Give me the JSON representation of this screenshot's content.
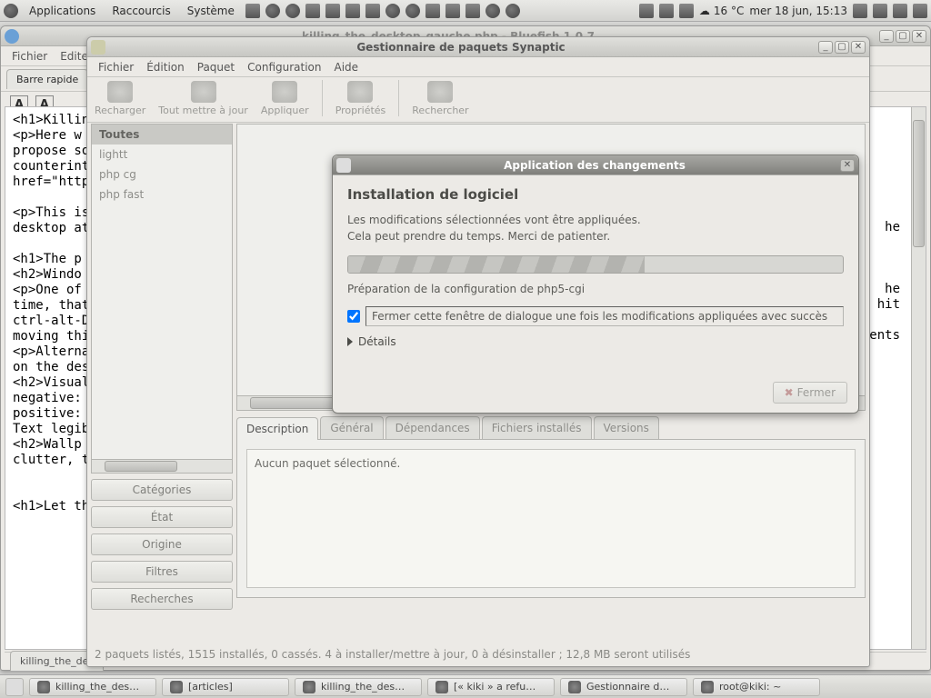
{
  "panel": {
    "menus": [
      "Applications",
      "Raccourcis",
      "Système"
    ],
    "weather": "16 °C",
    "clock": "mer 18 jun, 15:13"
  },
  "bluefish": {
    "title": "killing_the_desktop_gauche.php - Bluefish 1.0.7",
    "menus": [
      "Fichier",
      "Edite"
    ],
    "quickbar_tab": "Barre rapide",
    "doc_tab": "killing_the_des",
    "content": "<h1>Killing\n<p>Here w\npropose so\ncounterintu\nhref=\"http:/\n\n<p>This is\ndesktop at\n\n<h1>The p\n<h2>Windo\n<p>One of\ntime, that d\nctrl-alt-D, o\nmoving thin\n<p>Alterna\non the desk\n<h2>Visual\nnegative: d\npositive: m\nText legibili\n<h2>Wallp\nclutter, text\n\n\n<h1>Let th",
    "content_right": "he\n\n\n\nhe\nor hit\n\nents"
  },
  "synaptic": {
    "title": "Gestionnaire de paquets Synaptic",
    "menus": [
      "Fichier",
      "Édition",
      "Paquet",
      "Configuration",
      "Aide"
    ],
    "toolbar": [
      "Recharger",
      "Tout mettre à jour",
      "Appliquer",
      "Propriétés",
      "Rechercher"
    ],
    "categories": [
      "Toutes",
      "lightt",
      "php cg",
      "php fast"
    ],
    "side_buttons": [
      "Catégories",
      "État",
      "Origine",
      "Filtres",
      "Recherches"
    ],
    "tabs": [
      "Description",
      "Général",
      "Dépendances",
      "Fichiers installés",
      "Versions"
    ],
    "desc_empty": "Aucun paquet sélectionné.",
    "status": "2 paquets listés, 1515 installés, 0 cassés. 4 à installer/mettre à jour, 0 à désinstaller ; 12,8 MB seront utilisés"
  },
  "apply": {
    "title": "Application des changements",
    "heading": "Installation de logiciel",
    "line1": "Les modifications sélectionnées vont être appliquées.",
    "line2": "Cela peut prendre du temps. Merci de patienter.",
    "prep": "Préparation de la configuration de php5-cgi",
    "close_when_done": "Fermer cette fenêtre de dialogue une fois les modifications appliquées avec succès",
    "details": "Détails",
    "close_btn": "Fermer"
  },
  "taskbar": {
    "tasks": [
      "killing_the_des…",
      "[articles]",
      "killing_the_des…",
      "[« kiki » a refu…",
      "Gestionnaire d…",
      "root@kiki: ~"
    ]
  }
}
